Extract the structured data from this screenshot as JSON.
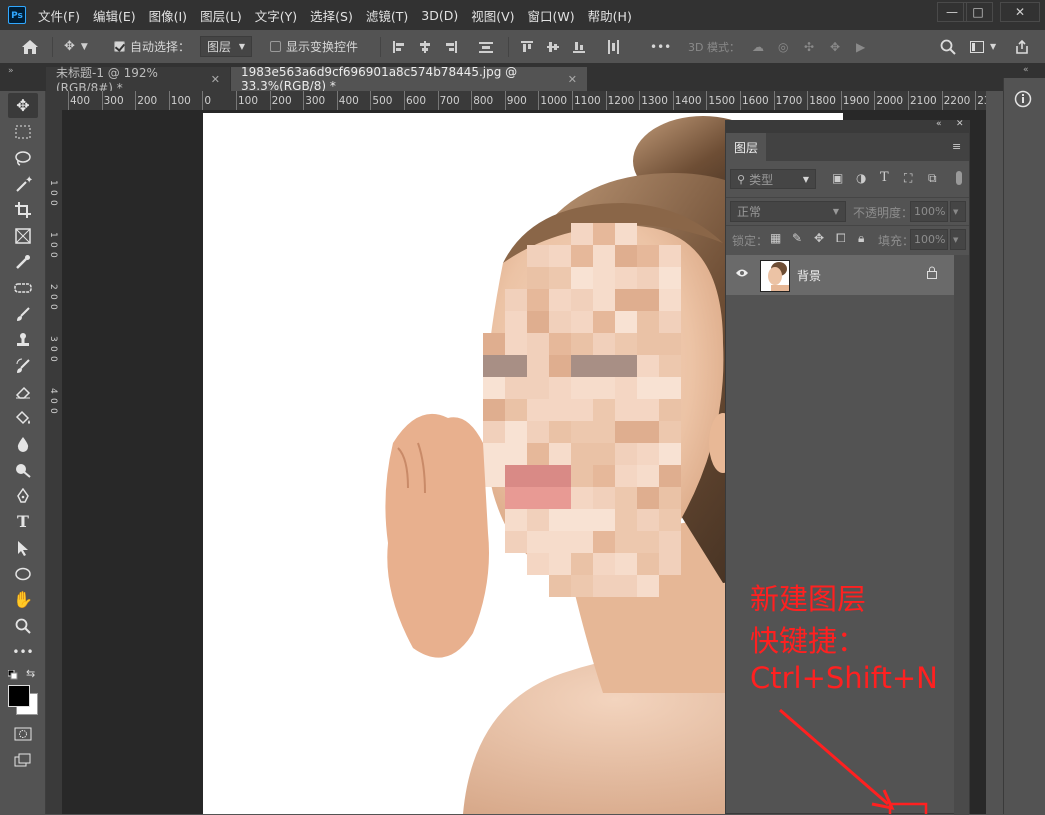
{
  "app": {
    "logo": "Ps"
  },
  "menu": [
    "文件(F)",
    "编辑(E)",
    "图像(I)",
    "图层(L)",
    "文字(Y)",
    "选择(S)",
    "滤镜(T)",
    "3D(D)",
    "视图(V)",
    "窗口(W)",
    "帮助(H)"
  ],
  "window_controls": {
    "minimize": "—",
    "maximize": "□",
    "close": "✕"
  },
  "options": {
    "auto_select_label": "自动选择：",
    "auto_select_checked": true,
    "auto_select_target": "图层",
    "show_transform_label": "显示变换控件",
    "show_transform_checked": false,
    "mode_3d_label": "3D 模式：",
    "more": "•••"
  },
  "tabs": [
    {
      "label": "未标题-1 @ 192%(RGB/8#) *",
      "active": false
    },
    {
      "label": "1983e563a6d9cf696901a8c574b78445.jpg @ 33.3%(RGB/8) *",
      "active": true
    }
  ],
  "ruler_h": [
    "400",
    "300",
    "200",
    "100",
    "0",
    "100",
    "200",
    "300",
    "400",
    "500",
    "600",
    "700",
    "800",
    "900",
    "1000",
    "1100",
    "1200",
    "1300",
    "1400",
    "1500",
    "1600",
    "1700",
    "1800",
    "1900",
    "2000",
    "2100",
    "2200",
    "23"
  ],
  "ruler_v": [
    "1",
    "0",
    "0",
    "1",
    "0",
    "0",
    "2",
    "0",
    "0",
    "3",
    "0",
    "0",
    "4",
    "0",
    "0"
  ],
  "layers_panel": {
    "title": "图层",
    "filter_placeholder": "类型",
    "blend_mode": "正常",
    "opacity_label": "不透明度：",
    "opacity_value": "100%",
    "lock_label": "锁定：",
    "fill_label": "填充：",
    "fill_value": "100%",
    "layers": [
      {
        "name": "背景",
        "visible": true,
        "locked": true
      }
    ]
  },
  "annotation": {
    "line1": "新建图层",
    "line2": "快键捷：",
    "line3": "Ctrl+Shift+N",
    "color": "#ff2020"
  },
  "colors": {
    "accent": "#31a8ff",
    "foreground": "#000000",
    "background": "#ffffff"
  }
}
